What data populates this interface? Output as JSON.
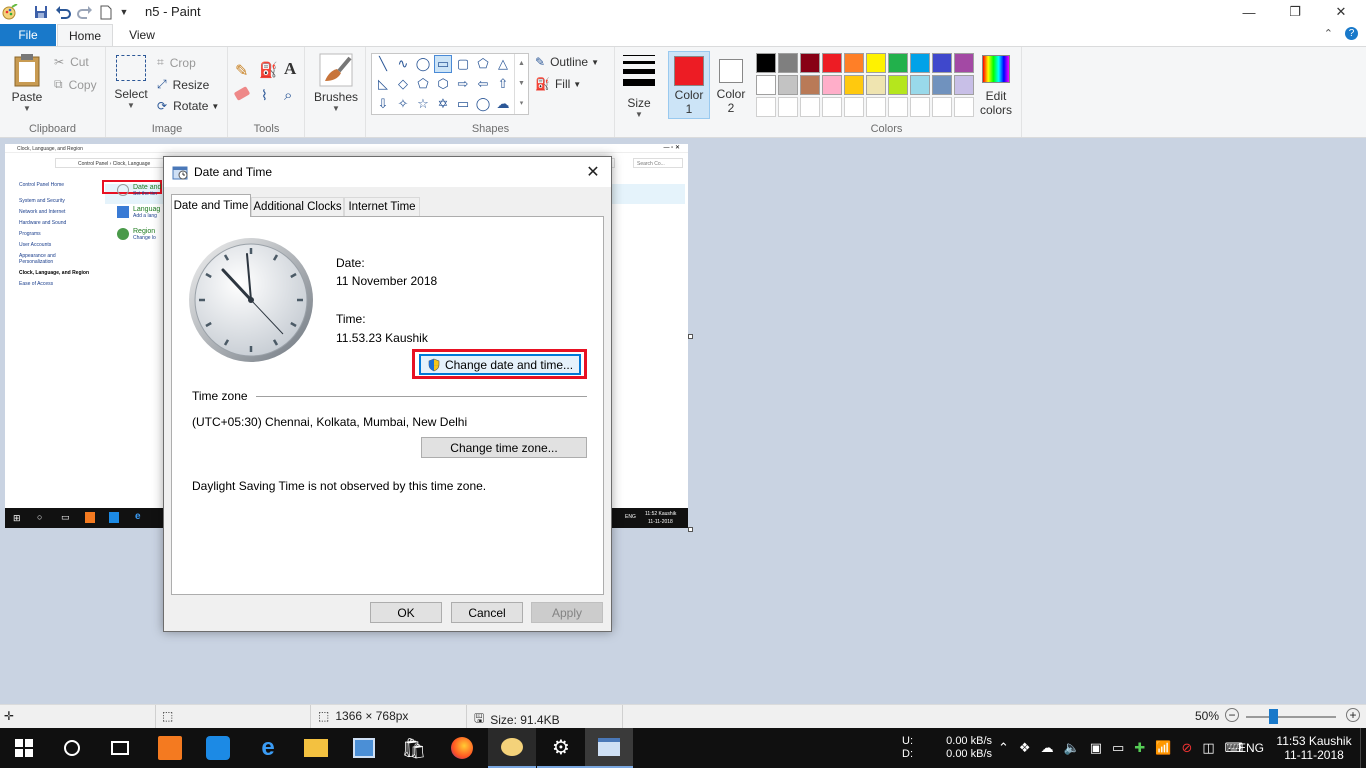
{
  "window": {
    "title": "n5 - Paint",
    "minimize": "—",
    "restore": "❐",
    "close": "✕"
  },
  "ribbon_tabs": {
    "file": "File",
    "home": "Home",
    "view": "View"
  },
  "clipboard": {
    "paste": "Paste",
    "cut": "Cut",
    "copy": "Copy",
    "label": "Clipboard"
  },
  "image": {
    "select": "Select",
    "crop": "Crop",
    "resize": "Resize",
    "rotate": "Rotate",
    "label": "Image"
  },
  "tools": {
    "label": "Tools"
  },
  "brushes": {
    "label": "Brushes"
  },
  "shapes": {
    "outline": "Outline",
    "fill": "Fill",
    "label": "Shapes"
  },
  "size": {
    "label": "Size"
  },
  "color1": {
    "line1": "Color",
    "line2": "1",
    "value": "#ed1c24"
  },
  "color2": {
    "line1": "Color",
    "line2": "2",
    "value": "#ffffff"
  },
  "colors": {
    "label": "Colors",
    "edit_line1": "Edit",
    "edit_line2": "colors",
    "row1": [
      "#000000",
      "#7f7f7f",
      "#880015",
      "#ed1c24",
      "#ff7f27",
      "#fff200",
      "#22b14c",
      "#00a2e8",
      "#3f48cc",
      "#a349a4"
    ],
    "row2": [
      "#ffffff",
      "#c3c3c3",
      "#b97a57",
      "#ffaec9",
      "#ffc90e",
      "#efe4b0",
      "#b5e61d",
      "#99d9ea",
      "#7092be",
      "#c8bfe7"
    ]
  },
  "canvas_content": {
    "window_title": "Clock, Language, and Region",
    "breadcrumb": "Control Panel › Clock, Language",
    "search": "Search Co...",
    "sidebar": [
      "Control Panel Home",
      "System and Security",
      "Network and Internet",
      "Hardware and Sound",
      "Programs",
      "User Accounts",
      "Appearance and Personalization",
      "Clock, Language, and Region",
      "Ease of Access"
    ],
    "items": [
      {
        "title": "Date and",
        "sub": "Set the tim"
      },
      {
        "title": "Languag",
        "sub": "Add a lang"
      },
      {
        "title": "Region",
        "sub": "Change lo"
      }
    ],
    "tray_clock": "11:52 Kaushik",
    "tray_date": "11-11-2018",
    "tray_lang": "ENG"
  },
  "dialog": {
    "title": "Date and Time",
    "tabs": [
      "Date and Time",
      "Additional Clocks",
      "Internet Time"
    ],
    "date_label": "Date:",
    "date_value": "11 November 2018",
    "time_label": "Time:",
    "time_value": "11.53.23 Kaushik",
    "change_datetime_button": "Change date and time...",
    "timezone_heading": "Time zone",
    "timezone_value": "(UTC+05:30) Chennai, Kolkata, Mumbai, New Delhi",
    "change_timezone_button": "Change time zone...",
    "dst_text": "Daylight Saving Time is not observed by this time zone.",
    "ok": "OK",
    "cancel": "Cancel",
    "apply": "Apply"
  },
  "statusbar": {
    "dimensions": "1366 × 768px",
    "size": "Size: 91.4KB",
    "zoom": "50%",
    "zoom_fraction": 0.5
  },
  "taskbar": {
    "net_up_label": "U:",
    "net_down_label": "D:",
    "net_up": "0.00 kB/s",
    "net_down": "0.00 kB/s",
    "lang": "ENG",
    "time": "11:53 Kaushik",
    "date": "11-11-2018"
  }
}
